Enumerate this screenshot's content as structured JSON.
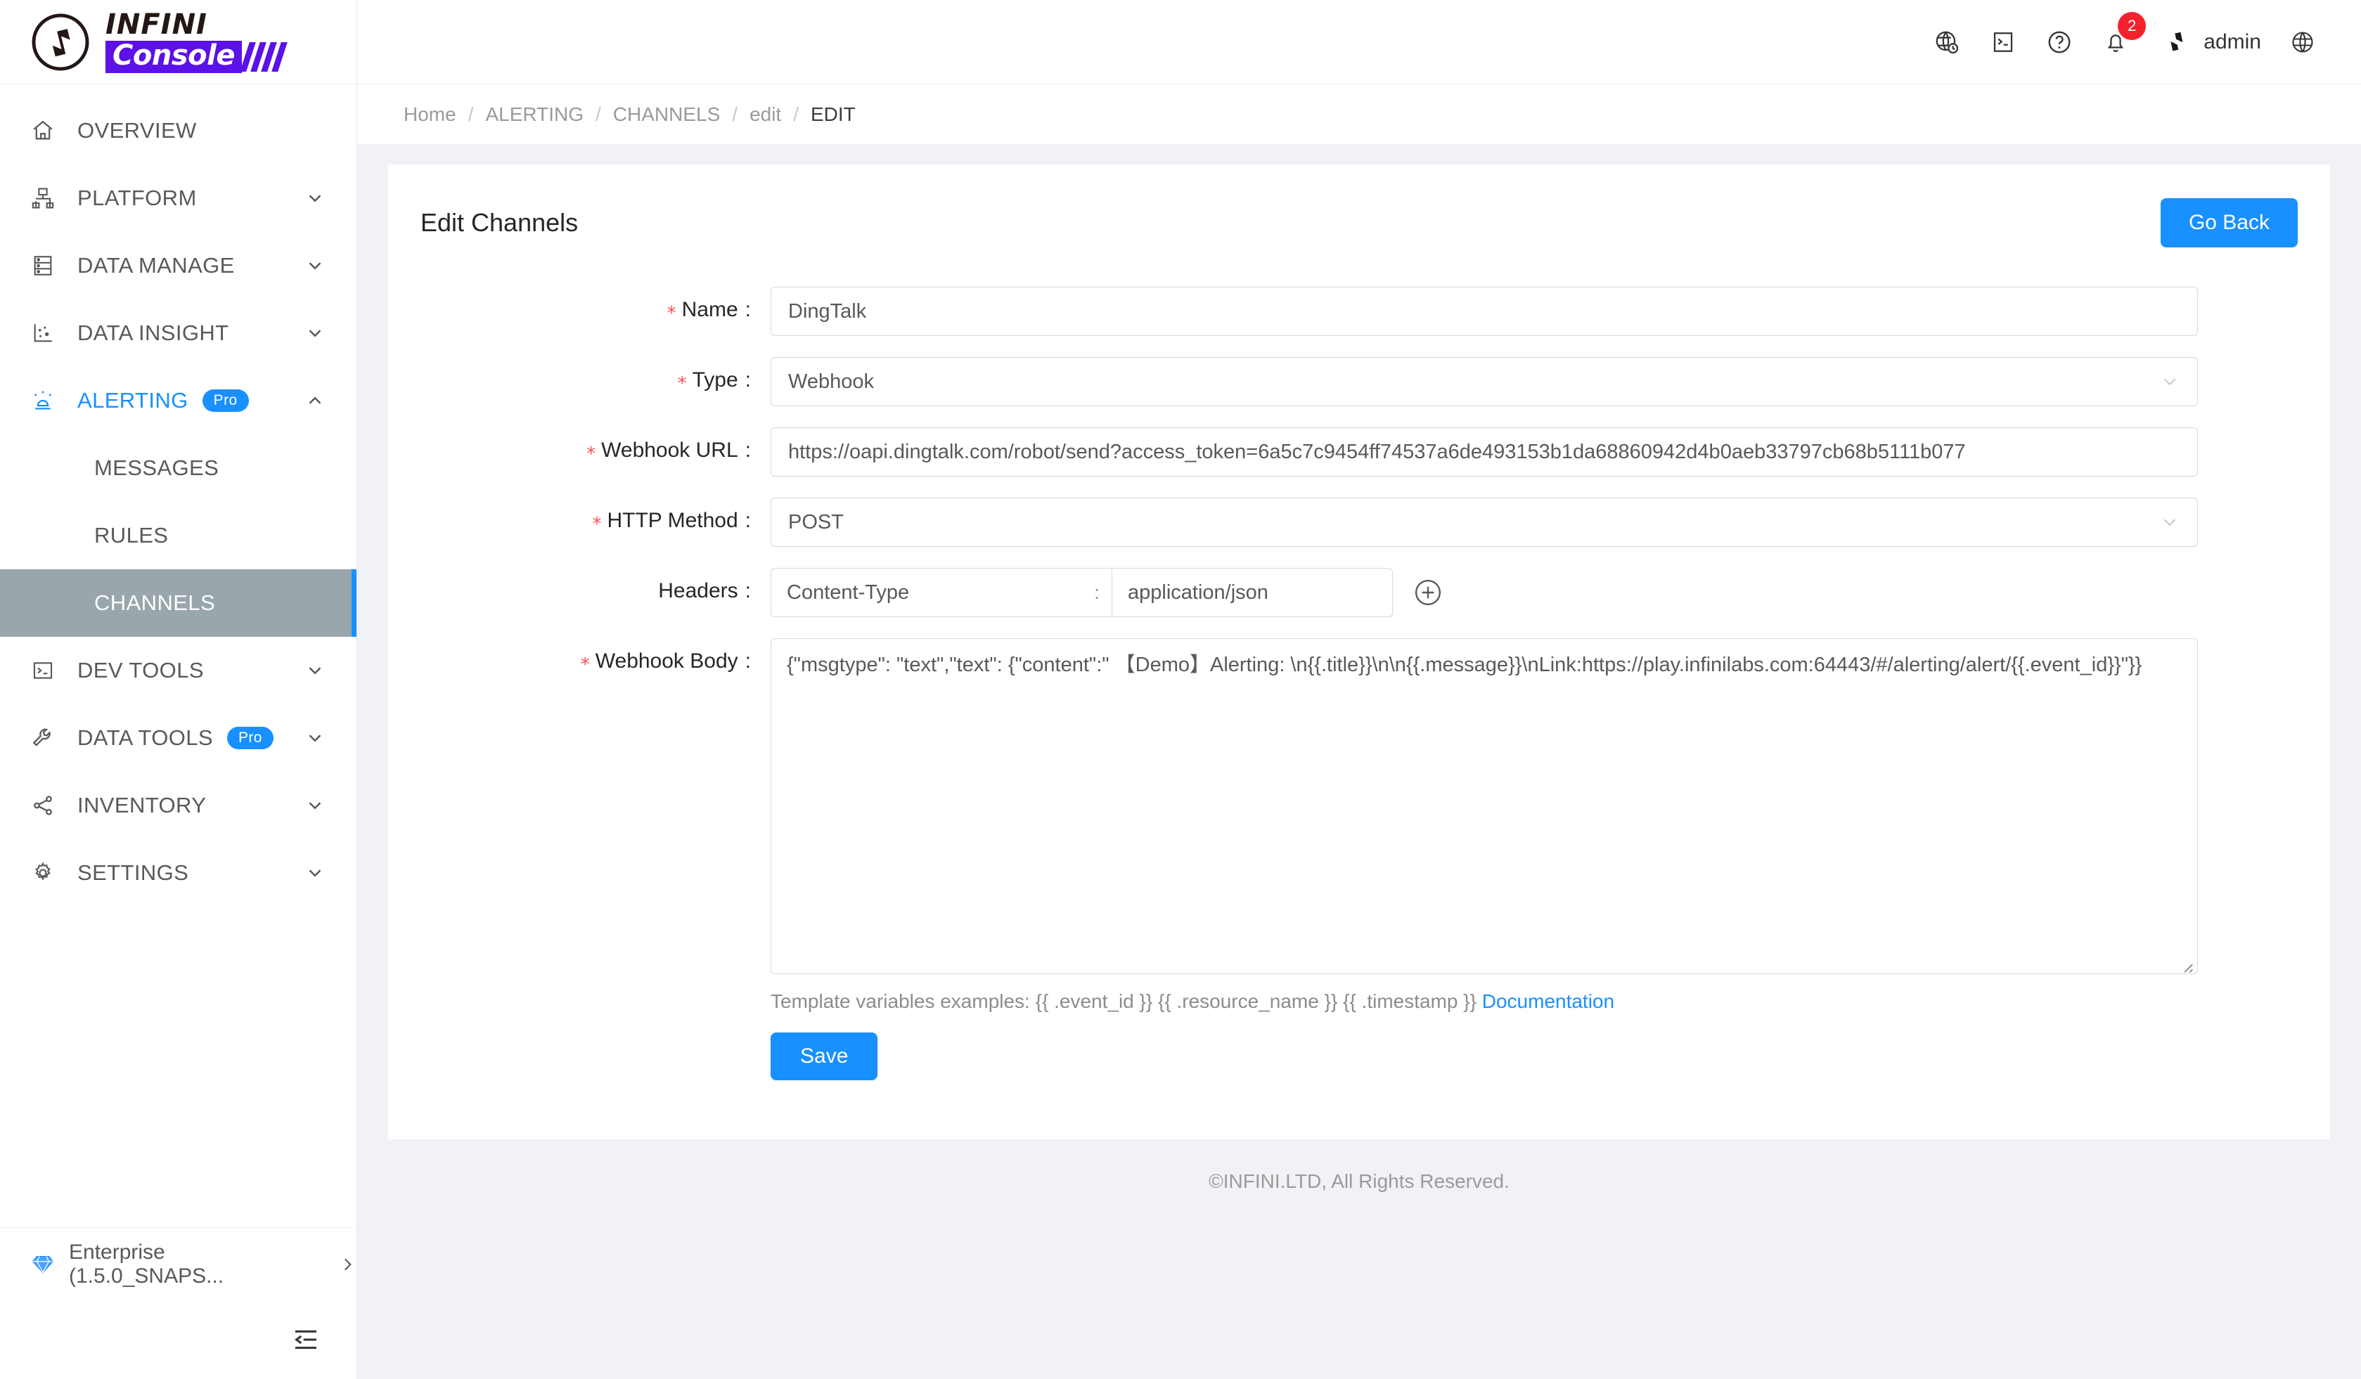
{
  "brand": {
    "name_top": "INFINI",
    "name_bottom": "Console",
    "accent_purple": "#5b11e8"
  },
  "sidebar": {
    "items": [
      {
        "label": "OVERVIEW",
        "icon": "home-icon",
        "expandable": false,
        "badge": null
      },
      {
        "label": "PLATFORM",
        "icon": "platform-icon",
        "expandable": true,
        "badge": null
      },
      {
        "label": "DATA MANAGE",
        "icon": "database-icon",
        "expandable": true,
        "badge": null
      },
      {
        "label": "DATA INSIGHT",
        "icon": "scatter-chart-icon",
        "expandable": true,
        "badge": null
      },
      {
        "label": "ALERTING",
        "icon": "alarm-icon",
        "expandable": true,
        "badge": "Pro",
        "expanded": true,
        "active": true
      },
      {
        "label": "DEV TOOLS",
        "icon": "terminal-icon",
        "expandable": true,
        "badge": null
      },
      {
        "label": "DATA TOOLS",
        "icon": "wrench-icon",
        "expandable": true,
        "badge": "Pro"
      },
      {
        "label": "INVENTORY",
        "icon": "share-nodes-icon",
        "expandable": true,
        "badge": null
      },
      {
        "label": "SETTINGS",
        "icon": "gear-icon",
        "expandable": true,
        "badge": null
      }
    ],
    "alerting_children": [
      {
        "label": "MESSAGES",
        "selected": false
      },
      {
        "label": "RULES",
        "selected": false
      },
      {
        "label": "CHANNELS",
        "selected": true
      }
    ],
    "footer": {
      "label": "Enterprise (1.5.0_SNAPS...",
      "icon": "diamond-icon",
      "chevron": "chevron-right-icon"
    },
    "collapse_icon": "menu-collapse-icon",
    "selected_bg": "#99a6ab",
    "selected_bar": "#1890ff"
  },
  "topbar": {
    "icons": [
      {
        "name": "globe-clock-icon"
      },
      {
        "name": "console-terminal-icon"
      },
      {
        "name": "help-circle-icon"
      },
      {
        "name": "bell-icon",
        "badge": "2"
      }
    ],
    "user": {
      "name": "admin",
      "avatar": "infini-avatar-icon"
    },
    "language_icon": "globe-icon",
    "badge_color": "#f5222d"
  },
  "breadcrumb": {
    "items": [
      "Home",
      "ALERTING",
      "CHANNELS",
      "edit",
      "EDIT"
    ],
    "separator": "/"
  },
  "card": {
    "title": "Edit Channels",
    "go_back_label": "Go Back"
  },
  "form": {
    "fields": {
      "name": {
        "label": "Name",
        "required": true,
        "value": "DingTalk",
        "placeholder": ""
      },
      "type": {
        "label": "Type",
        "required": true,
        "value": "Webhook",
        "control": "select"
      },
      "webhook_url": {
        "label": "Webhook URL",
        "required": true,
        "value": "https://oapi.dingtalk.com/robot/send?access_token=6a5c7c9454ff74537a6de493153b1da68860942d4b0aeb33797cb68b5111b077"
      },
      "http_method": {
        "label": "HTTP Method",
        "required": true,
        "value": "POST",
        "control": "select"
      },
      "headers": {
        "label": "Headers",
        "required": false,
        "key": "Content-Type",
        "separator": ":",
        "value": "application/json",
        "add_icon": "plus-circle-icon"
      },
      "webhook_body": {
        "label": "Webhook Body",
        "required": true,
        "value": "{\"msgtype\": \"text\",\"text\": {\"content\":\" 【Demo】Alerting: \\n{{.title}}\\n\\n{{.message}}\\nLink:https://play.infinilabs.com:64443/#/alerting/alert/{{.event_id}}\"}}"
      }
    },
    "hint_text": "Template variables examples: {{ .event_id }} {{ .resource_name }} {{ .timestamp }} ",
    "hint_link": "Documentation",
    "save_label": "Save",
    "required_mark": "*",
    "colon": ":"
  },
  "footer": {
    "copyright": "©INFINI.LTD, All Rights Reserved."
  }
}
